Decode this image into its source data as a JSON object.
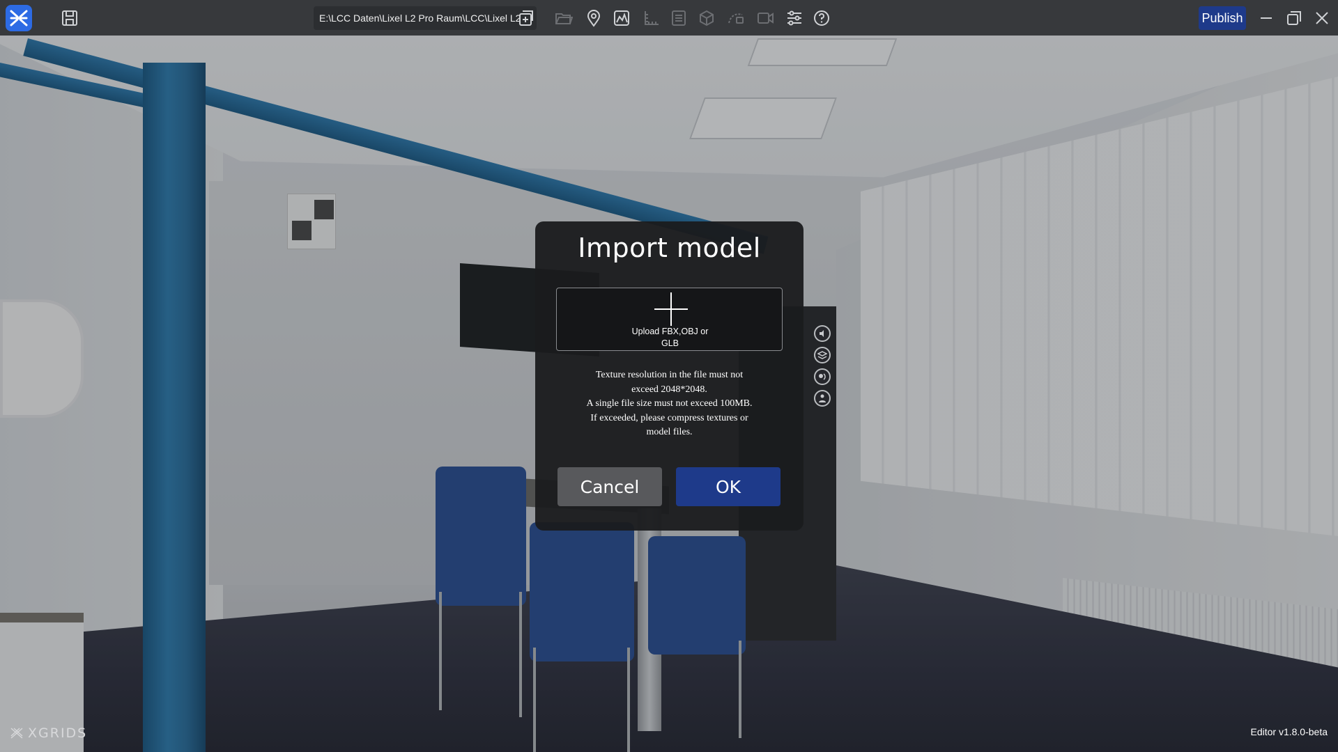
{
  "toolbar": {
    "file_path": "E:\\LCC Daten\\Lixel L2 Pro Raum\\LCC\\Lixel L2",
    "publish_label": "Publish",
    "icons": [
      "app-logo",
      "save-icon",
      "add-layer-icon",
      "folder-icon",
      "location-pin-icon",
      "image-chart-icon",
      "measure-icon",
      "list-icon",
      "cube-icon",
      "camera-path-icon",
      "video-icon",
      "settings-sliders-icon",
      "help-icon",
      "minimize-icon",
      "restore-icon",
      "close-icon"
    ]
  },
  "dialog": {
    "title": "Import model",
    "upload_label": "Upload FBX,OBJ or GLB",
    "notes": [
      "Texture resolution in the file must not",
      "exceed 2048*2048.",
      "A single file size must not exceed 100MB.",
      "If exceeded, please compress textures or",
      "model files."
    ],
    "cancel_label": "Cancel",
    "ok_label": "OK"
  },
  "footer": {
    "brand": "XGRIDS",
    "version": "Editor v1.8.0-beta"
  },
  "colors": {
    "accent": "#1e3a8a",
    "logo": "#2d6be4",
    "toolbar_bg": "#37393c",
    "dialog_bg": "#1a1b1e"
  }
}
